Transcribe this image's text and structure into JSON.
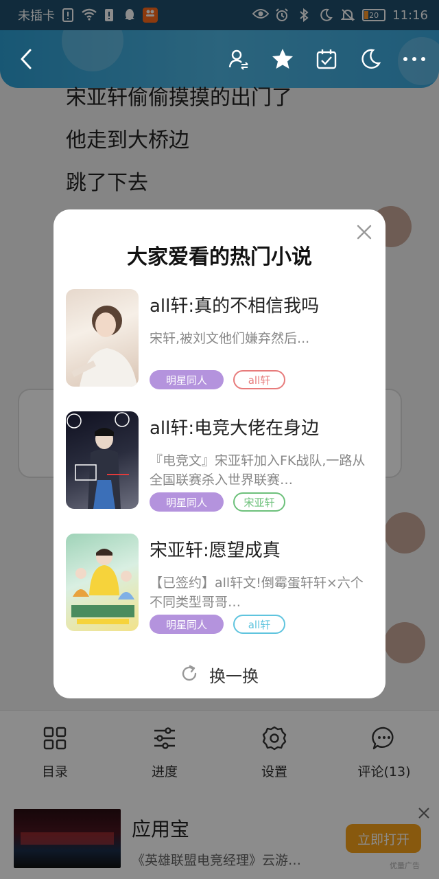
{
  "status_bar": {
    "carrier": "未插卡",
    "battery": "20",
    "time": "11:16",
    "left_icons": [
      "sim-alert-icon",
      "wifi-icon",
      "sd-card-icon",
      "qq-icon",
      "app-notification-icon"
    ],
    "right_icons": [
      "eye-icon",
      "alarm-icon",
      "bluetooth-icon",
      "moon-icon",
      "mute-icon"
    ]
  },
  "app_bar": {
    "icons": [
      "back-icon",
      "author-switch-icon",
      "star-icon",
      "calendar-check-icon",
      "night-mode-icon",
      "more-icon"
    ]
  },
  "content": {
    "lines": [
      "宋亚轩偷偷摸摸的出门了",
      "他走到大桥边",
      "跳了下去"
    ]
  },
  "modal": {
    "title": "大家爱看的热门小说",
    "books": [
      {
        "title": "all轩:真的不相信我吗",
        "description": "宋轩,被刘文他们嫌弃然后...",
        "category": "明星同人",
        "keyword": "all轩",
        "keyword_color": "#e77b7b"
      },
      {
        "title": "all轩:电竞大佬在身边",
        "description": "『电竞文』宋亚轩加入FK战队,一路从全国联赛杀入世界联赛…",
        "category": "明星同人",
        "keyword": "宋亚轩",
        "keyword_color": "#6cc07a"
      },
      {
        "title": "宋亚轩:愿望成真",
        "description": "【已签约】all轩文!倒霉蛋轩轩×六个不同类型哥哥…",
        "category": "明星同人",
        "keyword": "all轩",
        "keyword_color": "#5fc4de"
      }
    ],
    "refresh_label": "换一换"
  },
  "toolbar": {
    "items": [
      {
        "label": "目录",
        "icon": "grid-icon"
      },
      {
        "label": "进度",
        "icon": "sliders-icon"
      },
      {
        "label": "设置",
        "icon": "gear-icon"
      },
      {
        "label": "评论(13)",
        "icon": "chat-icon"
      }
    ]
  },
  "ad": {
    "title": "应用宝",
    "description": "《英雄联盟电竞经理》云游…",
    "button_label": "立即打开",
    "tag": "优量广告"
  },
  "colors": {
    "app_bar": "#3aa7dc",
    "status_bar": "#1f4f6d",
    "category_tag": "#b493dd",
    "ad_button": "#f7a21b"
  }
}
